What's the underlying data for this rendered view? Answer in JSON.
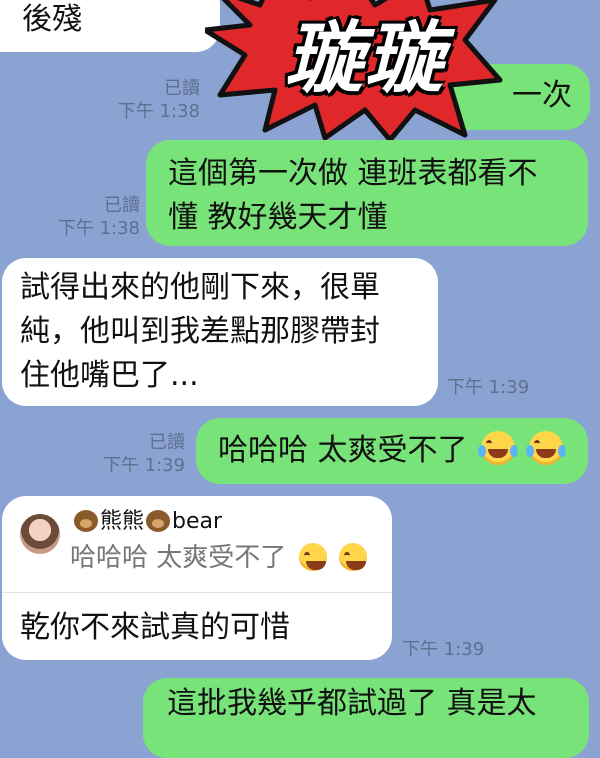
{
  "messages": [
    {
      "id": "m0",
      "side": "in",
      "text": "後殘"
    },
    {
      "id": "m1",
      "side": "out",
      "text": "一次",
      "read": "已讀",
      "time": "下午 1:38"
    },
    {
      "id": "m2",
      "side": "out",
      "line1": "這個第一次做 連班表都看不",
      "line2": "懂 教好幾天才懂",
      "read": "已讀",
      "time": "下午 1:38"
    },
    {
      "id": "m3",
      "side": "in",
      "line1": "試得出來的他剛下來，很單",
      "line2": "純，他叫到我差點那膠帶封",
      "line3": "住他嘴巴了...",
      "time": "下午 1:39"
    },
    {
      "id": "m4",
      "side": "out",
      "text": "哈哈哈 太爽受不了",
      "read": "已讀",
      "time": "下午 1:39",
      "emoji": [
        "joy-emoji",
        "joy-emoji"
      ]
    },
    {
      "id": "m5",
      "side": "in",
      "reply_name": "熊熊",
      "reply_name_en": "bear",
      "reply_quote": "哈哈哈 太爽受不了",
      "text": "乾你不來試真的可惜",
      "time": "下午 1:39"
    },
    {
      "id": "m6",
      "side": "out",
      "text": "這批我幾乎都試過了 真是太"
    }
  ],
  "sticker": {
    "text": "璇璇",
    "colors": {
      "burst": "#e0282a",
      "outline": "#111111",
      "text": "#ffffff"
    }
  },
  "colors": {
    "background": "#8aa3d3",
    "incoming": "#ffffff",
    "outgoing": "#78e378",
    "meta": "#5f6f8f"
  }
}
